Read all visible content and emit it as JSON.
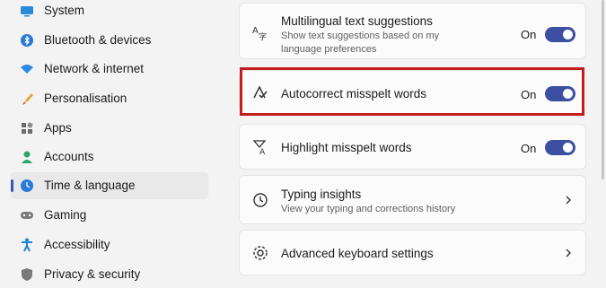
{
  "sidebar": {
    "items": [
      {
        "label": "System",
        "icon": "monitor-icon",
        "active": false
      },
      {
        "label": "Bluetooth & devices",
        "icon": "bluetooth-icon",
        "active": false
      },
      {
        "label": "Network & internet",
        "icon": "wifi-icon",
        "active": false
      },
      {
        "label": "Personalisation",
        "icon": "brush-icon",
        "active": false
      },
      {
        "label": "Apps",
        "icon": "apps-icon",
        "active": false
      },
      {
        "label": "Accounts",
        "icon": "person-icon",
        "active": false
      },
      {
        "label": "Time & language",
        "icon": "globe-clock-icon",
        "active": true
      },
      {
        "label": "Gaming",
        "icon": "gamepad-icon",
        "active": false
      },
      {
        "label": "Accessibility",
        "icon": "accessibility-icon",
        "active": false
      },
      {
        "label": "Privacy & security",
        "icon": "shield-icon",
        "active": false
      }
    ]
  },
  "settings": [
    {
      "title": "Multilingual text suggestions",
      "subtitle": "Show text suggestions based on my language preferences",
      "state": "On",
      "control": "toggle",
      "icon": "language-text-icon"
    },
    {
      "title": "Autocorrect misspelt words",
      "state": "On",
      "control": "toggle",
      "icon": "autocorrect-icon"
    },
    {
      "title": "Highlight misspelt words",
      "state": "On",
      "control": "toggle",
      "icon": "highlight-text-icon"
    },
    {
      "title": "Typing insights",
      "subtitle": "View your typing and corrections history",
      "control": "chevron",
      "icon": "history-icon"
    },
    {
      "title": "Advanced keyboard settings",
      "control": "chevron",
      "icon": "gear-icon"
    }
  ],
  "colors": {
    "accent": "#3c4fa0",
    "highlight_border": "#c31e1e"
  }
}
